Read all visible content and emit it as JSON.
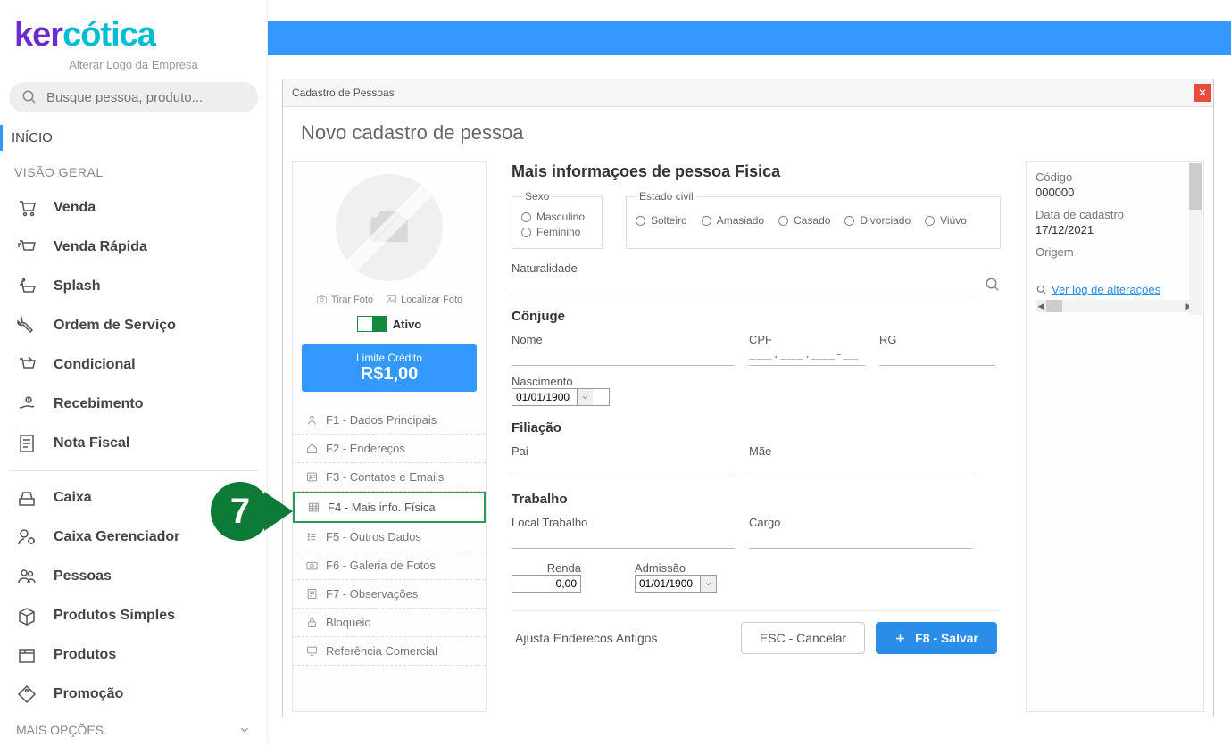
{
  "sidebar": {
    "logo_sub": "Alterar Logo da Empresa",
    "search_placeholder": "Busque pessoa, produto...",
    "active": "INÍCIO",
    "section": "VISÃO GERAL",
    "items": [
      "Venda",
      "Venda Rápida",
      "Splash",
      "Ordem de Serviço",
      "Condicional",
      "Recebimento",
      "Nota Fiscal"
    ],
    "items2": [
      "Caixa",
      "Caixa Gerenciador",
      "Pessoas",
      "Produtos Simples",
      "Produtos",
      "Promoção"
    ],
    "more": "MAIS OPÇÕES"
  },
  "modal": {
    "window": "Cadastro de Pessoas",
    "title": "Novo cadastro de pessoa",
    "photo": {
      "take": "Tirar Foto",
      "find": "Localizar Foto",
      "status": "Ativo"
    },
    "credit": {
      "label": "Limite Crédito",
      "value": "R$1,00"
    },
    "tabs": [
      "F1 - Dados Principais",
      "F2 - Endereços",
      "F3 - Contatos e Emails",
      "F4 - Mais info. Física",
      "F5 - Outros Dados",
      "F6 - Galeria de Fotos",
      "F7 - Observações",
      "Bloqueio",
      "Referência Comercial"
    ],
    "callout": "7",
    "form": {
      "h1": "Mais informaçoes de pessoa Fisica",
      "sexo": {
        "legend": "Sexo",
        "opts": [
          "Masculino",
          "Feminino"
        ]
      },
      "civil": {
        "legend": "Estado civil",
        "opts": [
          "Solteiro",
          "Amasiado",
          "Casado",
          "Divorciado",
          "Viúvo"
        ]
      },
      "naturalidade": "Naturalidade",
      "conjuge": {
        "h": "Cônjuge",
        "nome": "Nome",
        "cpf": "CPF",
        "cpf_mask": "___.___.___-__",
        "rg": "RG",
        "nasc": "Nascimento",
        "nasc_val": "01/01/1900"
      },
      "filiacao": {
        "h": "Filiação",
        "pai": "Pai",
        "mae": "Mãe"
      },
      "trabalho": {
        "h": "Trabalho",
        "local": "Local Trabalho",
        "cargo": "Cargo",
        "renda": "Renda",
        "renda_val": "0,00",
        "adm": "Admissão",
        "adm_val": "01/01/1900"
      },
      "bottom": {
        "txt": "Ajusta Enderecos Antigos",
        "cancel": "ESC - Cancelar",
        "save": "F8 - Salvar"
      }
    },
    "right": {
      "codigo_l": "Código",
      "codigo_v": "000000",
      "data_l": "Data de cadastro",
      "data_v": "17/12/2021",
      "origem_l": "Origem",
      "log": "Ver log de alterações"
    }
  }
}
